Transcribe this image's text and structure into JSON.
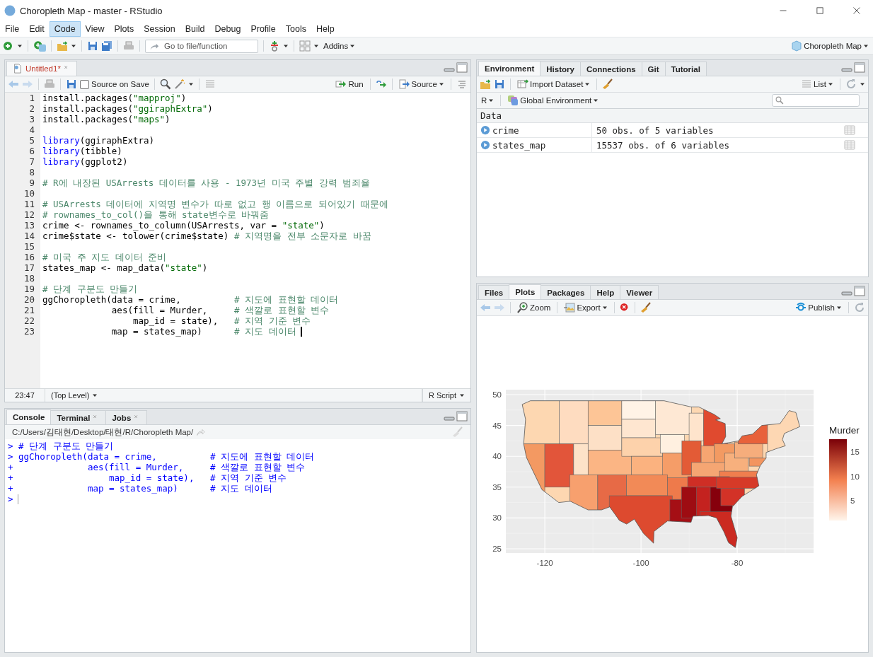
{
  "window": {
    "title": "Choropleth Map - master - RStudio"
  },
  "menu": [
    {
      "label": "File",
      "selected": false
    },
    {
      "label": "Edit",
      "selected": false
    },
    {
      "label": "Code",
      "selected": true
    },
    {
      "label": "View",
      "selected": false
    },
    {
      "label": "Plots",
      "selected": false
    },
    {
      "label": "Session",
      "selected": false
    },
    {
      "label": "Build",
      "selected": false
    },
    {
      "label": "Debug",
      "selected": false
    },
    {
      "label": "Profile",
      "selected": false
    },
    {
      "label": "Tools",
      "selected": false
    },
    {
      "label": "Help",
      "selected": false
    }
  ],
  "toolbar": {
    "goto_placeholder": "Go to file/function",
    "addins": "Addins",
    "project": "Choropleth Map"
  },
  "editor": {
    "tabs": [
      {
        "label": "Untitled1*",
        "modified": true,
        "selected": true
      }
    ],
    "source_on_save": {
      "label": "Source on Save",
      "checked": false
    },
    "run": "Run",
    "source": "Source",
    "lines": [
      {
        "number": "1",
        "segments": [
          {
            "kind": "plain",
            "text": "install.packages("
          },
          {
            "kind": "string",
            "text": "\"mapproj\""
          },
          {
            "kind": "plain",
            "text": ")"
          }
        ]
      },
      {
        "number": "2",
        "segments": [
          {
            "kind": "plain",
            "text": "install.packages("
          },
          {
            "kind": "string",
            "text": "\"ggiraphExtra\""
          },
          {
            "kind": "plain",
            "text": ")"
          }
        ]
      },
      {
        "number": "3",
        "segments": [
          {
            "kind": "plain",
            "text": "install.packages("
          },
          {
            "kind": "string",
            "text": "\"maps\""
          },
          {
            "kind": "plain",
            "text": ")"
          }
        ]
      },
      {
        "number": "4"
      },
      {
        "number": "5",
        "segments": [
          {
            "kind": "keyword",
            "text": "library"
          },
          {
            "kind": "plain",
            "text": "(ggiraphExtra)"
          }
        ]
      },
      {
        "number": "6",
        "segments": [
          {
            "kind": "keyword",
            "text": "library"
          },
          {
            "kind": "plain",
            "text": "(tibble)"
          }
        ]
      },
      {
        "number": "7",
        "segments": [
          {
            "kind": "keyword",
            "text": "library"
          },
          {
            "kind": "plain",
            "text": "(ggplot2)"
          }
        ]
      },
      {
        "number": "8"
      },
      {
        "number": "9",
        "segments": [
          {
            "kind": "comment",
            "text": "# R에 내장된 USArrests 데이터를 사용 - 1973년 미국 주별 강력 범죄율"
          }
        ]
      },
      {
        "number": "10"
      },
      {
        "number": "11",
        "segments": [
          {
            "kind": "comment",
            "text": "# USArrests 데이터에 지역명 변수가 따로 없고 행 이름으로 되어있기 때문에"
          }
        ]
      },
      {
        "number": "12",
        "segments": [
          {
            "kind": "comment",
            "text": "# rownames_to_col()을 통해 state변수로 바꿔줌"
          }
        ]
      },
      {
        "number": "13",
        "segments": [
          {
            "kind": "plain",
            "text": "crime <- rownames_to_column(USArrests, var = "
          },
          {
            "kind": "string",
            "text": "\"state\""
          },
          {
            "kind": "plain",
            "text": ")"
          }
        ]
      },
      {
        "number": "14",
        "segments": [
          {
            "kind": "plain",
            "text": "crime$state <- tolower(crime$state) "
          },
          {
            "kind": "comment",
            "text": "# 지역명을 전부 소문자로 바꿈"
          }
        ]
      },
      {
        "number": "15"
      },
      {
        "number": "16",
        "segments": [
          {
            "kind": "comment",
            "text": "# 미국 주 지도 데이터 준비"
          }
        ]
      },
      {
        "number": "17",
        "segments": [
          {
            "kind": "plain",
            "text": "states_map <- map_data("
          },
          {
            "kind": "string",
            "text": "\"state\""
          },
          {
            "kind": "plain",
            "text": ")"
          }
        ]
      },
      {
        "number": "18"
      },
      {
        "number": "19",
        "segments": [
          {
            "kind": "comment",
            "text": "# 단계 구분도 만들기"
          }
        ]
      },
      {
        "number": "20",
        "segments": [
          {
            "kind": "plain",
            "text": "ggChoropleth(data = crime,          "
          },
          {
            "kind": "comment",
            "text": "# 지도에 표현할 데이터"
          }
        ]
      },
      {
        "number": "21",
        "segments": [
          {
            "kind": "plain",
            "text": "             aes(fill = Murder,     "
          },
          {
            "kind": "comment",
            "text": "# 색깔로 표현할 변수"
          }
        ]
      },
      {
        "number": "22",
        "segments": [
          {
            "kind": "plain",
            "text": "                 map_id = state),   "
          },
          {
            "kind": "comment",
            "text": "# 지역 기준 변수"
          }
        ]
      },
      {
        "number": "23",
        "segments": [
          {
            "kind": "plain",
            "text": "             map = states_map)      "
          },
          {
            "kind": "comment",
            "text": "# 지도 데이터"
          }
        ]
      }
    ],
    "cursor_position": "23:47",
    "scope": "(Top Level)",
    "file_type": "R Script"
  },
  "console": {
    "tabs": [
      {
        "label": "Console",
        "selected": true,
        "closable": false
      },
      {
        "label": "Terminal",
        "selected": false,
        "closable": true
      },
      {
        "label": "Jobs",
        "selected": false,
        "closable": true
      }
    ],
    "path": "C:/Users/김태현/Desktop/태현/R/Choropleth Map/",
    "lines": [
      {
        "prompt": ">",
        "text": "# 단계 구분도 만들기"
      },
      {
        "prompt": ">",
        "text": "ggChoropleth(data = crime,          # 지도에 표현할 데이터"
      },
      {
        "prompt": "+",
        "text": "             aes(fill = Murder,     # 색깔로 표현할 변수"
      },
      {
        "prompt": "+",
        "text": "                 map_id = state),   # 지역 기준 변수"
      },
      {
        "prompt": "+",
        "text": "             map = states_map)      # 지도 데이터"
      }
    ],
    "input_prompt": ">"
  },
  "environment": {
    "tabs": [
      {
        "label": "Environment",
        "selected": true
      },
      {
        "label": "History",
        "selected": false
      },
      {
        "label": "Connections",
        "selected": false
      },
      {
        "label": "Git",
        "selected": false
      },
      {
        "label": "Tutorial",
        "selected": false
      }
    ],
    "import": "Import Dataset",
    "view": "List",
    "language": "R",
    "scope": "Global Environment",
    "section": "Data",
    "rows": [
      {
        "name": "crime",
        "value": "50 obs. of 5 variables"
      },
      {
        "name": "states_map",
        "value": "15537 obs. of 6 variables"
      }
    ]
  },
  "plots_pane": {
    "tabs": [
      {
        "label": "Files",
        "selected": false
      },
      {
        "label": "Plots",
        "selected": true
      },
      {
        "label": "Packages",
        "selected": false
      },
      {
        "label": "Help",
        "selected": false
      },
      {
        "label": "Viewer",
        "selected": false
      }
    ],
    "zoom": "Zoom",
    "export": "Export",
    "publish": "Publish",
    "plot": {
      "yticks": [
        "50",
        "45",
        "40",
        "35",
        "30",
        "25"
      ],
      "xticks": [
        "-120",
        "-100",
        "-80"
      ],
      "legend": {
        "title": "Murder",
        "ticks": [
          "15",
          "10",
          "5"
        ]
      }
    }
  }
}
